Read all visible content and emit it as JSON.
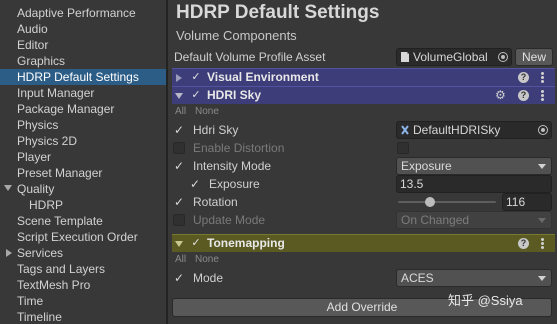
{
  "sidebar": {
    "items": [
      {
        "label": "Adaptive Performance"
      },
      {
        "label": "Audio"
      },
      {
        "label": "Editor"
      },
      {
        "label": "Graphics"
      },
      {
        "label": "HDRP Default Settings"
      },
      {
        "label": "Input Manager"
      },
      {
        "label": "Package Manager"
      },
      {
        "label": "Physics"
      },
      {
        "label": "Physics 2D"
      },
      {
        "label": "Player"
      },
      {
        "label": "Preset Manager"
      },
      {
        "label": "Quality"
      },
      {
        "label": "HDRP"
      },
      {
        "label": "Scene Template"
      },
      {
        "label": "Script Execution Order"
      },
      {
        "label": "Services"
      },
      {
        "label": "Tags and Layers"
      },
      {
        "label": "TextMesh Pro"
      },
      {
        "label": "Time"
      },
      {
        "label": "Timeline"
      }
    ],
    "selected": "HDRP Default Settings"
  },
  "main": {
    "title": "HDRP Default Settings",
    "section": "Volume Components",
    "profile_label": "Default Volume Profile Asset",
    "profile_value": "VolumeGlobal",
    "new_button": "New",
    "components": {
      "visual_environment": {
        "title": "Visual Environment"
      },
      "hdri_sky": {
        "title": "HDRI Sky",
        "all": "All",
        "none": "None",
        "hdri_sky_label": "Hdri Sky",
        "hdri_sky_value": "DefaultHDRISky",
        "enable_distortion_label": "Enable Distortion",
        "intensity_mode_label": "Intensity Mode",
        "intensity_mode_value": "Exposure",
        "exposure_label": "Exposure",
        "exposure_value": "13.5",
        "rotation_label": "Rotation",
        "rotation_value": "116",
        "rotation_fraction": 0.322,
        "update_mode_label": "Update Mode",
        "update_mode_value": "On Changed"
      },
      "tonemapping": {
        "title": "Tonemapping",
        "all": "All",
        "none": "None",
        "mode_label": "Mode",
        "mode_value": "ACES"
      }
    },
    "add_override_button": "Add Override"
  },
  "watermark": "知乎 @Ssiya",
  "colors": {
    "selected_row": "#2c5d87",
    "hdri_header": "#3d3d7a",
    "tonemapping_header": "#5a5a22",
    "background": "#383838"
  }
}
